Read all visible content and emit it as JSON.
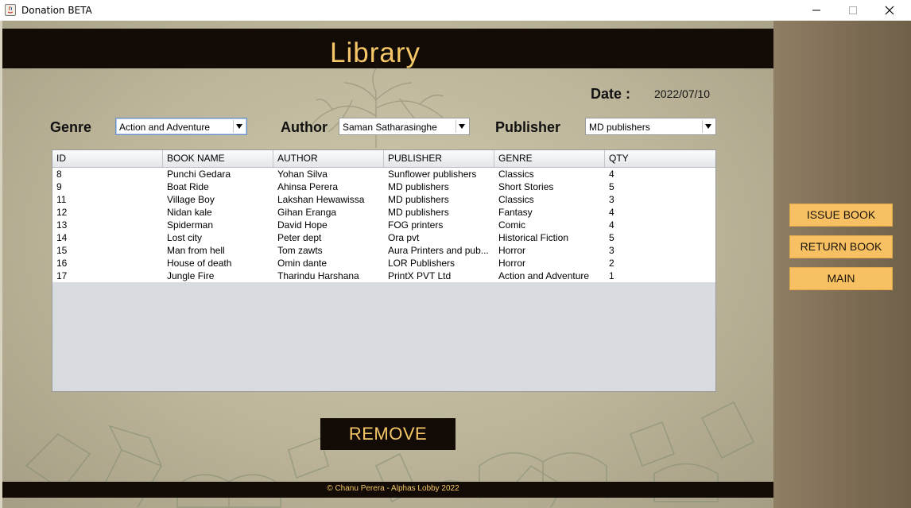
{
  "window": {
    "title": "Donation BETA"
  },
  "header": {
    "title": "Library"
  },
  "date": {
    "label": "Date :",
    "value": "2022/07/10"
  },
  "filters": {
    "genre": {
      "label": "Genre",
      "value": "Action and Adventure"
    },
    "author": {
      "label": "Author",
      "value": "Saman Satharasinghe"
    },
    "publisher": {
      "label": "Publisher",
      "value": "MD publishers"
    }
  },
  "table": {
    "columns": [
      "ID",
      "BOOK NAME",
      "AUTHOR",
      "PUBLISHER",
      "GENRE",
      "QTY"
    ],
    "rows": [
      [
        "8",
        "Punchi Gedara",
        "Yohan Silva",
        "Sunflower publishers",
        "Classics",
        "4"
      ],
      [
        "9",
        "Boat Ride",
        "Ahinsa Perera",
        "MD publishers",
        "Short Stories",
        "5"
      ],
      [
        "11",
        "Village Boy",
        "Lakshan Hewawissa",
        "MD publishers",
        "Classics",
        "3"
      ],
      [
        "12",
        "Nidan kale",
        "Gihan Eranga",
        "MD publishers",
        "Fantasy",
        "4"
      ],
      [
        "13",
        "Spiderman",
        "David Hope",
        "FOG printers",
        "Comic",
        "4"
      ],
      [
        "14",
        "Lost city",
        "Peter dept",
        "Ora pvt",
        "Historical Fiction",
        "5"
      ],
      [
        "15",
        "Man from hell",
        "Tom zawts",
        "Aura Printers and pub...",
        "Horror",
        "3"
      ],
      [
        "16",
        "House of death",
        "Omin dante",
        "LOR Publishers",
        "Horror",
        "2"
      ],
      [
        "17",
        "Jungle Fire",
        "Tharindu Harshana",
        "PrintX PVT Ltd",
        "Action and Adventure",
        "1"
      ]
    ]
  },
  "actions": {
    "remove": "REMOVE"
  },
  "sidebar": {
    "issue": "ISSUE BOOK",
    "return": "RETURN BOOK",
    "main": "MAIN"
  },
  "footer": {
    "text": "© Chanu Perera - Alphas Lobby 2022"
  },
  "colors": {
    "dark_bar": "#120b06",
    "accent_gold": "#f6c768",
    "side_button": "#f7c163",
    "parchment": "#bcb59a"
  }
}
